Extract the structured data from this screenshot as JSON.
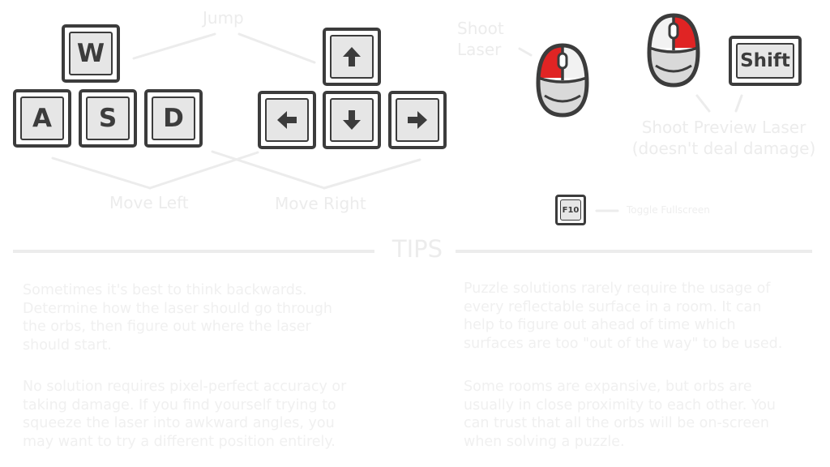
{
  "keys": {
    "w": "W",
    "a": "A",
    "s": "S",
    "d": "D",
    "up": "up-arrow-icon",
    "left": "left-arrow-icon",
    "down": "down-arrow-icon",
    "right": "right-arrow-icon",
    "shift": "Shift",
    "f10": "F10"
  },
  "labels": {
    "jump": "Jump",
    "move_left": "Move Left",
    "move_right": "Move Right",
    "shoot_laser": "Shoot\nLaser",
    "shoot_preview": "Shoot Preview Laser\n(doesn't deal damage)",
    "toggle_fullscreen": "Toggle Fullscreen"
  },
  "tips": {
    "title": "TIPS",
    "items": [
      "Sometimes it's best to think backwards.\nDetermine how the laser should go through\nthe orbs, then figure out where the laser\nshould start.",
      "Puzzle solutions rarely require the usage of\nevery reflectable surface in a room.  It can\nhelp to figure out ahead of time which\nsurfaces are too \"out of the way\" to be used.",
      "No solution requires pixel-perfect accuracy or\ntaking damage.  If you find yourself trying to\nsqueeze the laser into awkward angles, you\nmay want to try a different position entirely.",
      "Some rooms are expansive, but orbs are\nusually in close proximity to each other.  You\ncan trust that all the orbs will be on-screen\nwhen solving a puzzle."
    ]
  },
  "colors": {
    "outline": "#3c3c3c",
    "key_face": "#e6e6e6",
    "mouse_button_active": "#e02424",
    "mouse_body": "#d9d9d9",
    "faded_text": "#ececec"
  },
  "icons": {
    "mouse_left": "mouse-left-click-icon",
    "mouse_right": "mouse-right-click-icon"
  }
}
